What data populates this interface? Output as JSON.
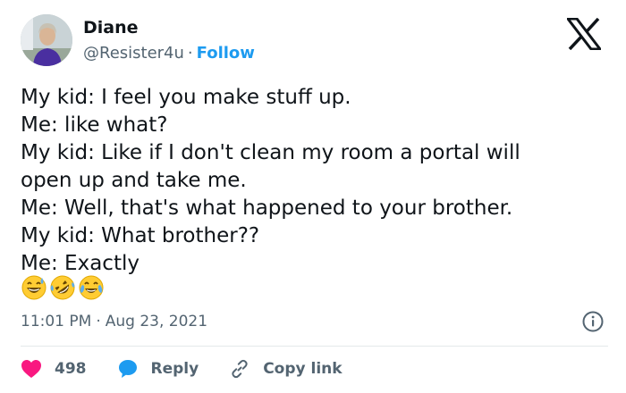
{
  "author": {
    "name": "Diane",
    "handle": "@Resister4u",
    "separator": "·",
    "follow_label": "Follow",
    "avatar": "avatar-photo"
  },
  "brand": {
    "icon": "x-logo-icon",
    "color": "#0f1419"
  },
  "tweet": {
    "lines": [
      "My kid: I feel you make stuff up.",
      "Me: like what?",
      "My kid: Like if I don't clean my room a portal will",
      "open up and take me.",
      "Me: Well, that's what happened to your brother.",
      "My kid: What brother??",
      "Me: Exactly"
    ],
    "emojis": [
      "grinning-sweat-emoji",
      "rolling-on-floor-laughing-emoji",
      "tears-of-joy-emoji"
    ]
  },
  "meta": {
    "time": "11:01 PM",
    "separator": "·",
    "date": "Aug 23, 2021",
    "info_icon": "info-icon"
  },
  "actions": {
    "like_count": "498",
    "reply_label": "Reply",
    "copy_link_label": "Copy link"
  },
  "colors": {
    "accent": "#1d9bf0",
    "heart": "#f91880",
    "secondary_text": "#536471",
    "primary_text": "#0f1419"
  }
}
